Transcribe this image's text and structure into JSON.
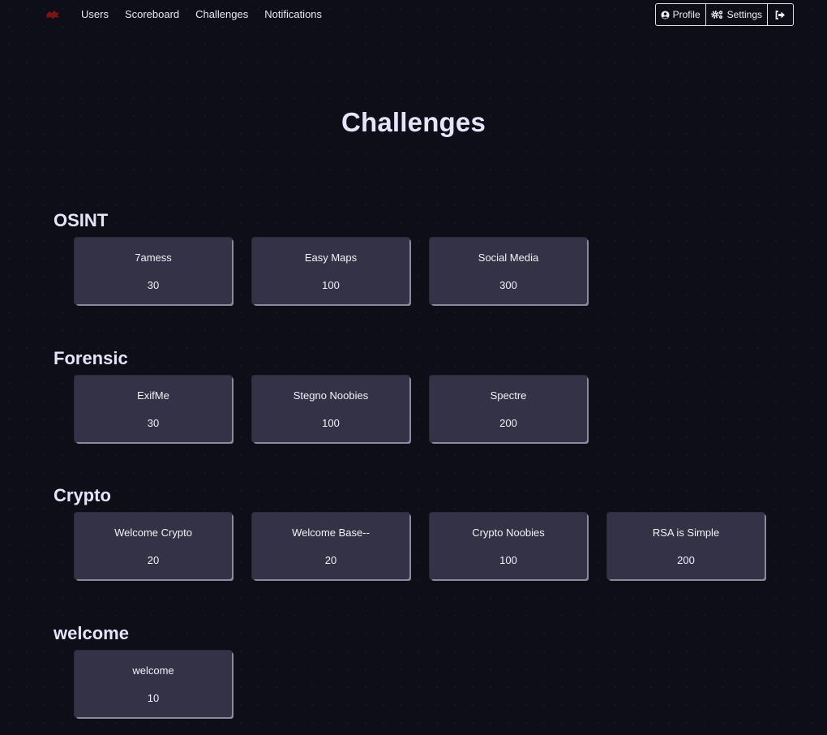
{
  "nav": {
    "links": [
      "Users",
      "Scoreboard",
      "Challenges",
      "Notifications"
    ],
    "profile_label": "Profile",
    "settings_label": "Settings",
    "logo_color": "#8b1a1a"
  },
  "page": {
    "title": "Challenges"
  },
  "categories": [
    {
      "name": "OSINT",
      "challenges": [
        {
          "name": "7amess",
          "points": "30"
        },
        {
          "name": "Easy Maps",
          "points": "100"
        },
        {
          "name": "Social Media",
          "points": "300"
        }
      ]
    },
    {
      "name": "Forensic",
      "challenges": [
        {
          "name": "ExifMe",
          "points": "30"
        },
        {
          "name": "Stegno Noobies",
          "points": "100"
        },
        {
          "name": "Spectre",
          "points": "200"
        }
      ]
    },
    {
      "name": "Crypto",
      "challenges": [
        {
          "name": "Welcome Crypto",
          "points": "20"
        },
        {
          "name": "Welcome Base--",
          "points": "20"
        },
        {
          "name": "Crypto Noobies",
          "points": "100"
        },
        {
          "name": "RSA is Simple",
          "points": "200"
        }
      ]
    },
    {
      "name": "welcome",
      "challenges": [
        {
          "name": "welcome",
          "points": "10"
        }
      ]
    }
  ]
}
